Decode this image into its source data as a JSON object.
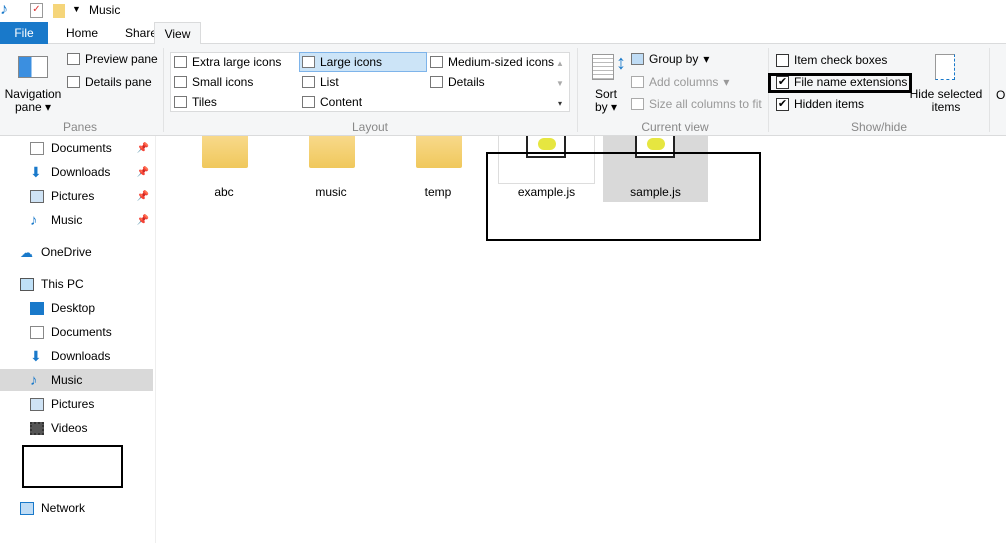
{
  "window": {
    "title": "Music"
  },
  "tabs": [
    {
      "label": "File"
    },
    {
      "label": "Home"
    },
    {
      "label": "Share"
    },
    {
      "label": "View"
    }
  ],
  "ribbon": {
    "panes": {
      "label": "Panes",
      "navigation_pane": "Navigation",
      "navigation_pane2": "pane",
      "preview_pane": "Preview pane",
      "details_pane": "Details pane"
    },
    "layout": {
      "label": "Layout",
      "items": [
        "Extra large icons",
        "Large icons",
        "Medium-sized icons",
        "Small icons",
        "List",
        "Details",
        "Tiles",
        "Content"
      ],
      "selected": "Large icons"
    },
    "current_view": {
      "label": "Current view",
      "sort_by": "Sort",
      "sort_by2": "by",
      "group_by": "Group by",
      "add_columns": "Add columns",
      "size_columns": "Size all columns to fit"
    },
    "show_hide": {
      "label": "Show/hide",
      "item_check_boxes": {
        "label": "Item check boxes",
        "checked": false
      },
      "file_name_extensions": {
        "label": "File name extensions",
        "checked": true
      },
      "hidden_items": {
        "label": "Hidden items",
        "checked": true
      },
      "hide_selected": "Hide selected",
      "hide_selected2": "items"
    },
    "options_partial": "O"
  },
  "nav": {
    "quick_access": [
      "Documents",
      "Downloads",
      "Pictures",
      "Music"
    ],
    "onedrive": "OneDrive",
    "this_pc": "This PC",
    "this_pc_items": [
      "Desktop",
      "Documents",
      "Downloads",
      "Music",
      "Pictures",
      "Videos"
    ],
    "selected": "Music",
    "network": "Network"
  },
  "files": [
    {
      "name": "abc",
      "type": "folder"
    },
    {
      "name": "music",
      "type": "folder"
    },
    {
      "name": "temp",
      "type": "folder"
    },
    {
      "name": "example.js",
      "type": "js"
    },
    {
      "name": "sample.js",
      "type": "js",
      "selected": true
    }
  ],
  "colors": {
    "accent": "#1979ca",
    "selected_bg": "#d9d9d9",
    "layout_selected": "#cce4f7"
  }
}
